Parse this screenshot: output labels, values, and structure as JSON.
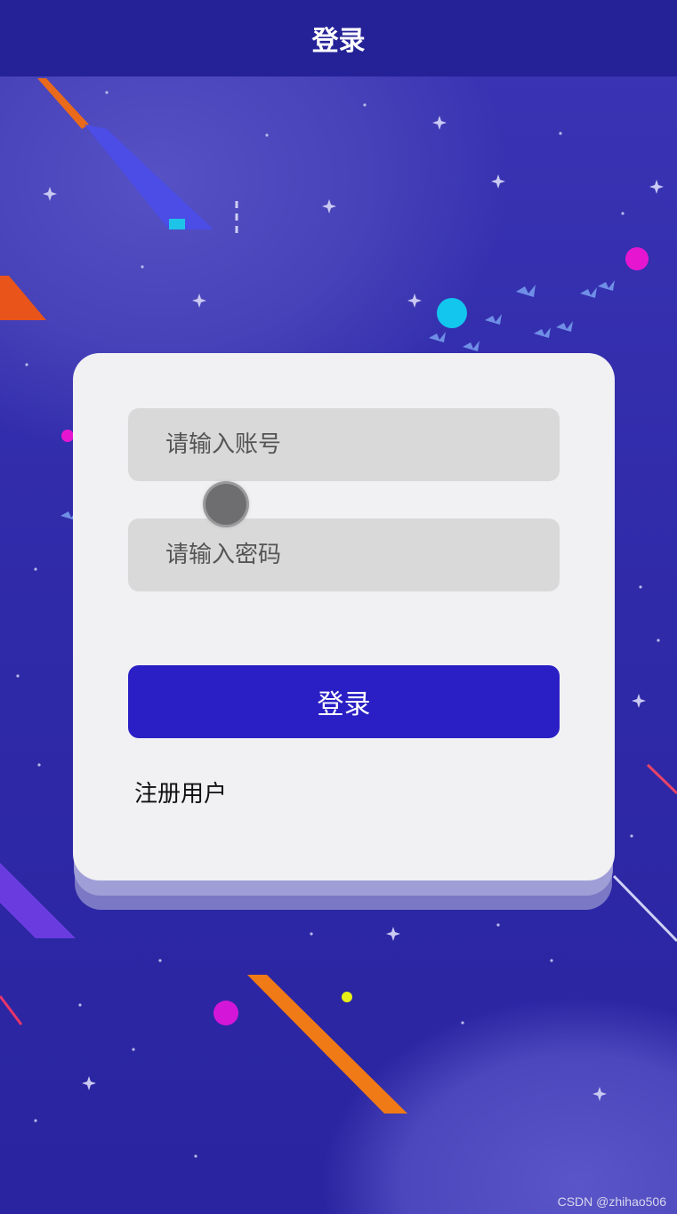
{
  "header": {
    "title": "登录"
  },
  "form": {
    "account_placeholder": "请输入账号",
    "password_placeholder": "请输入密码",
    "login_label": "登录",
    "register_label": "注册用户"
  },
  "watermark": "CSDN @zhihao506",
  "colors": {
    "header_bg": "#252298",
    "background": "#2f2aa8",
    "card_bg": "#f1f0f3",
    "button_bg": "#2a1fc4",
    "input_bg": "#d9d9da"
  }
}
